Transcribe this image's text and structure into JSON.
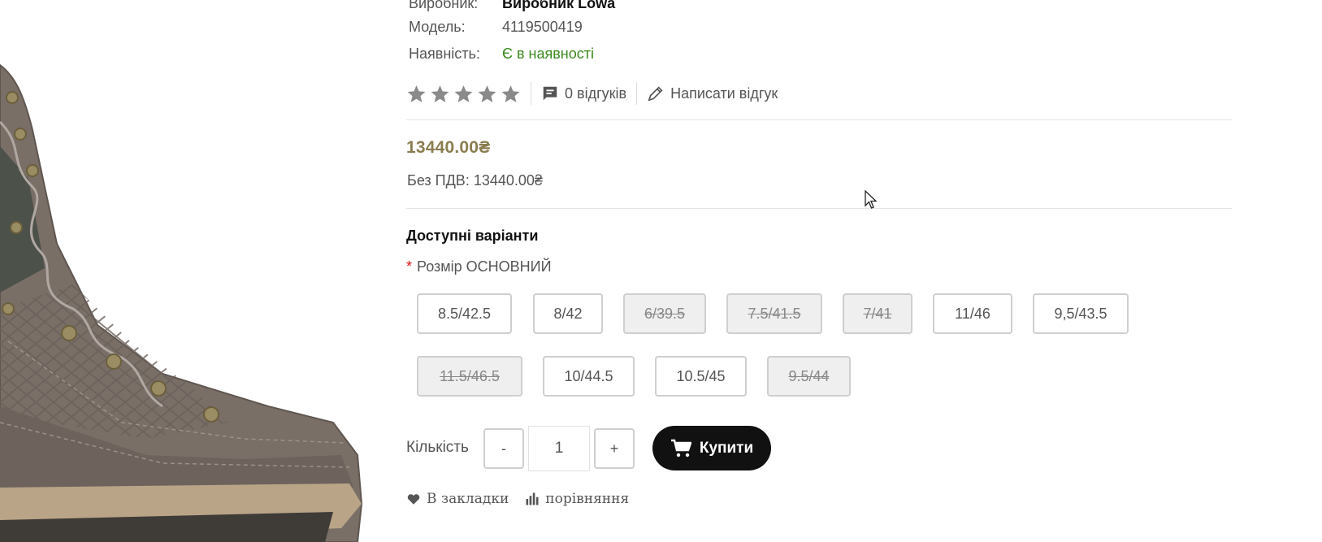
{
  "specs": {
    "manufacturer": {
      "label": "Виробник:",
      "value": "Виробник Lowa"
    },
    "model": {
      "label": "Модель:",
      "value": "4119500419"
    },
    "availability": {
      "label": "Наявність:",
      "value": "Є в наявності"
    }
  },
  "rating": {
    "stars_filled": 0,
    "stars_total": 5
  },
  "reviews": {
    "count_label": "0 відгуків",
    "write_label": "Написати відгук"
  },
  "price": {
    "main": "13440.00₴",
    "no_vat": "Без ПДВ: 13440.00₴"
  },
  "options": {
    "title": "Доступні варіанти",
    "required_mark": "*",
    "size_label": "Розмір ОСНОВНИЙ",
    "sizes": [
      {
        "label": "8.5/42.5",
        "available": true
      },
      {
        "label": "8/42",
        "available": true
      },
      {
        "label": "6/39.5",
        "available": false
      },
      {
        "label": "7.5/41.5",
        "available": false
      },
      {
        "label": "7/41",
        "available": false
      },
      {
        "label": "11/46",
        "available": true
      },
      {
        "label": "9,5/43.5",
        "available": true
      },
      {
        "label": "11.5/46.5",
        "available": false
      },
      {
        "label": "10/44.5",
        "available": true
      },
      {
        "label": "10.5/45",
        "available": true
      },
      {
        "label": "9.5/44",
        "available": false
      }
    ]
  },
  "quantity": {
    "label": "Кількість",
    "minus": "-",
    "plus": "+",
    "value": "1"
  },
  "buy": {
    "label": "Купити"
  },
  "actions": {
    "wishlist": "В закладки",
    "compare": "порівняння"
  },
  "colors": {
    "price": "#8a7d4f",
    "stock": "#3b8a1e",
    "buy_bg": "#111111"
  }
}
